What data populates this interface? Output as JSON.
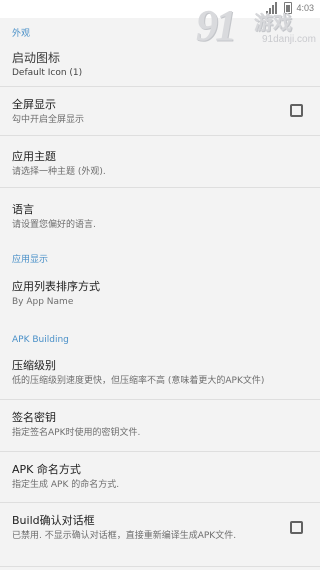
{
  "status_bar": {
    "time": "4:03"
  },
  "watermark": {
    "logo": "91",
    "brand": "游戏",
    "url": "91danji.com"
  },
  "sections": {
    "appearance": "外观",
    "app_display": "应用显示",
    "apk_building": "APK Building"
  },
  "prefs": {
    "launcher_icon": {
      "title": "启动图标",
      "summary": "Default Icon (1)"
    },
    "fullscreen": {
      "title": "全屏显示",
      "summary": "勾中开启全屏显示",
      "checked": false
    },
    "theme": {
      "title": "应用主题",
      "summary": "请选择一种主题 (外观)."
    },
    "language": {
      "title": "语言",
      "summary": "请设置您偏好的语言."
    },
    "sort_order": {
      "title": "应用列表排序方式",
      "summary": "By App Name"
    },
    "compression": {
      "title": "压缩级别",
      "summary": "低的压缩级别速度更快，但压缩率不高 (意味着更大的APK文件)"
    },
    "signing_key": {
      "title": "签名密钥",
      "summary": "指定签名APK时使用的密钥文件."
    },
    "apk_naming": {
      "title": "APK 命名方式",
      "summary": "指定生成 APK 的命名方式."
    },
    "build_dialog": {
      "title": "Build确认对话框",
      "summary": "已禁用. 不显示确认对话框，直接重新编译生成APK文件.",
      "checked": false
    }
  },
  "colors": {
    "accent": "#4a90c8",
    "background": "#f3f3f3",
    "divider": "#dedede"
  }
}
